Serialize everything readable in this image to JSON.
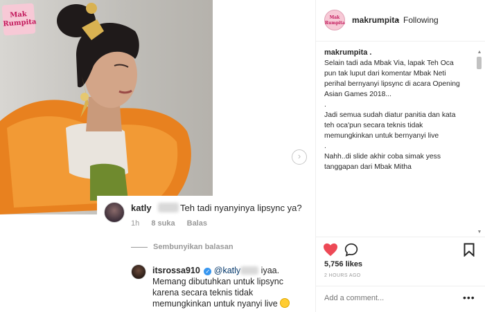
{
  "post": {
    "logo_line1": "Mak",
    "logo_line2": "Rumpita",
    "username": "makrumpita",
    "separator": "•",
    "follow_status": "Following",
    "caption_username": "makrumpita .",
    "caption_text": "Selain tadi ada Mbak Via, lapak Teh Oca\npun tak luput dari komentar Mbak Neti\nperihal bernyanyi lipsync di acara Opening\nAsian Games 2018...\n.\nJadi semua sudah diatur panitia dan kata\nteh oca'pun secara teknis tidak\nmemungkinkan untuk bernyanyi live\n.\nNahh..di slide akhir coba simak yess\ntanggapan dari Mbak Mitha",
    "likes": "5,756 likes",
    "time_ago": "2 HOURS AGO",
    "comment_placeholder": "Add a comment...",
    "more_icon": "•••",
    "next_icon": "›"
  },
  "comments": {
    "first": {
      "username": "katly",
      "text": "Teh tadi nyanyinya lipsync ya?",
      "time": "1h",
      "likes": "8 suka",
      "reply": "Balas"
    },
    "hide_replies": "Sembunyikan balasan",
    "reply": {
      "username": "itsrossa910",
      "verified_icon": "✓",
      "mention": "@katly",
      "text_part1": "iyaa.",
      "text_part2": "Memang dibutuhkan untuk lipsync karena secara teknis tidak memungkinkan untuk nyanyi live"
    }
  },
  "icons": {
    "heart": "heart-icon",
    "comment": "comment-icon",
    "save": "bookmark-icon"
  },
  "colors": {
    "heart": "#ed4956",
    "verified": "#3897f0",
    "mention": "#003569"
  }
}
